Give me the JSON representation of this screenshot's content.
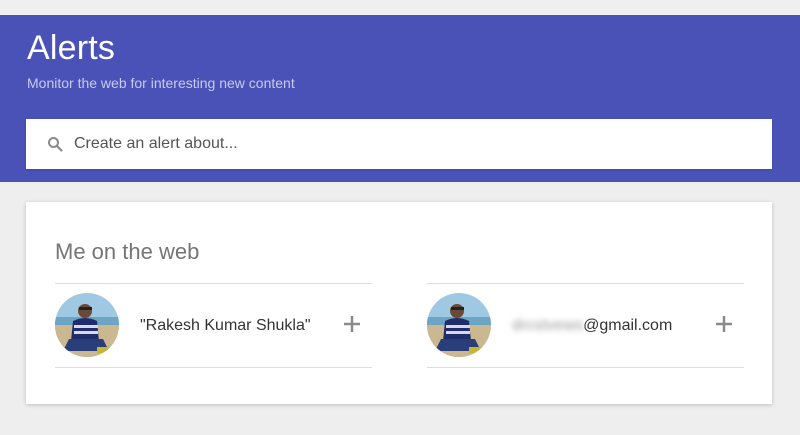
{
  "header": {
    "title": "Alerts",
    "subtitle": "Monitor the web for interesting new content",
    "bg_color": "#4a52b8"
  },
  "search": {
    "placeholder": "Create an alert about...",
    "value": "",
    "icon": "search-icon"
  },
  "me_on_web": {
    "title": "Me on the web",
    "entries": [
      {
        "label": "\"Rakesh Kumar Shukla\"",
        "action_icon": "plus-icon"
      },
      {
        "label_hidden": "drcstvews",
        "label_visible": "@gmail.com",
        "action_icon": "plus-icon"
      }
    ]
  }
}
